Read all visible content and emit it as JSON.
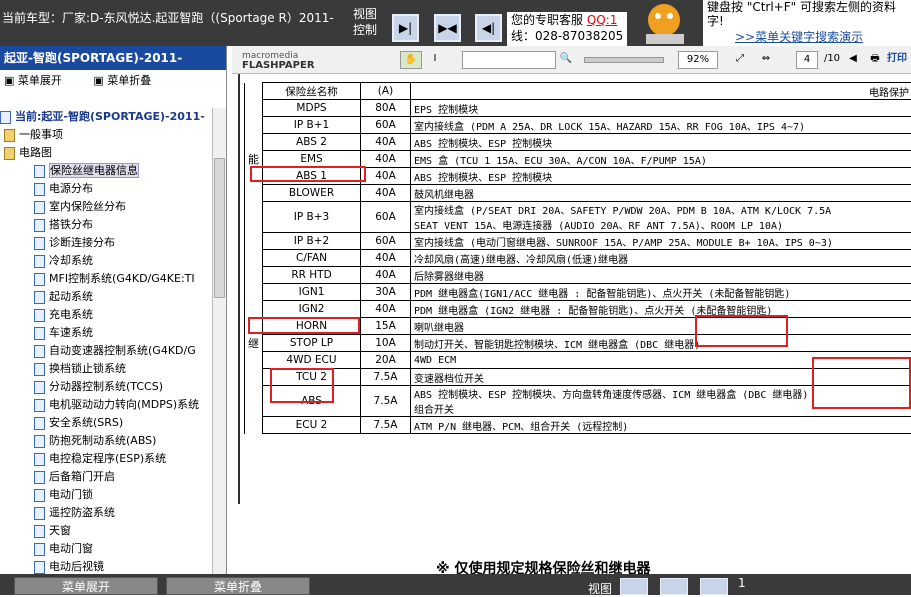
{
  "topbar": {
    "crumb": "当前车型：厂家:D-东风悦达.起亚智跑（(Sportage R）2011-",
    "view_label": "视图",
    "control_label": "控制",
    "nav": [
      "▶|",
      "▶◀",
      "◀|"
    ],
    "service_line1": "您的专职客服",
    "service_qq": "QQ:1",
    "service_line2": "线：028-87038205",
    "hint_line1": "键盘按 \"Ctrl+F\" 可搜索左侧的资料",
    "hint_line2": "字!",
    "hint_link": ">>菜单关键字搜索演示"
  },
  "sidebar": {
    "title": "起亚-智跑(SPORTAGE)-2011-",
    "expand": "菜单展开",
    "collapse": "菜单折叠",
    "current": "当前:起亚-智跑(SPORTAGE)-2011-",
    "items": [
      {
        "label": "一般事项",
        "level": 0
      },
      {
        "label": "电路图",
        "level": 0
      },
      {
        "label": "保险丝继电器信息",
        "level": 1
      },
      {
        "label": "电源分布",
        "level": 1
      },
      {
        "label": "室内保险丝分布",
        "level": 1
      },
      {
        "label": "搭铁分布",
        "level": 1
      },
      {
        "label": "诊断连接分布",
        "level": 1
      },
      {
        "label": "冷却系统",
        "level": 1
      },
      {
        "label": "MFI控制系统(G4KD/G4KE:TI",
        "level": 1
      },
      {
        "label": "起动系统",
        "level": 1
      },
      {
        "label": "充电系统",
        "level": 1
      },
      {
        "label": "车速系统",
        "level": 1
      },
      {
        "label": "自动变速器控制系统(G4KD/G",
        "level": 1
      },
      {
        "label": "换档锁止锁系统",
        "level": 1
      },
      {
        "label": "分动器控制系统(TCCS)",
        "level": 1
      },
      {
        "label": "电机驱动动力转向(MDPS)系统",
        "level": 1
      },
      {
        "label": "安全系统(SRS)",
        "level": 1
      },
      {
        "label": "防抱死制动系统(ABS)",
        "level": 1
      },
      {
        "label": "电控稳定程序(ESP)系统",
        "level": 1
      },
      {
        "label": "后备箱门开启",
        "level": 1
      },
      {
        "label": "电动门锁",
        "level": 1
      },
      {
        "label": "遥控防盗系统",
        "level": 1
      },
      {
        "label": "天窗",
        "level": 1
      },
      {
        "label": "电动门窗",
        "level": 1
      },
      {
        "label": "电动后视镜",
        "level": 1
      }
    ]
  },
  "viewer": {
    "logo_top": "macromedia",
    "logo_bottom": "FLASHPAPER",
    "zoom": "92%",
    "page_current": "4",
    "page_total": "/10",
    "print": "打印"
  },
  "table": {
    "header": [
      "保险丝名称",
      "(A)",
      "电路保护"
    ],
    "group1": "能",
    "group2": "继",
    "rows": [
      {
        "name": "MDPS",
        "amp": "80A",
        "desc": "EPS 控制模块"
      },
      {
        "name": "IP B+1",
        "amp": "60A",
        "desc": "室内接线盒 (PDM A 25A、DR LOCK 15A、HAZARD 15A、RR FOG 10A、IPS 4~7)"
      },
      {
        "name": "ABS 2",
        "amp": "40A",
        "desc": "ABS 控制模块、ESP 控制模块"
      },
      {
        "name": "EMS",
        "amp": "40A",
        "desc": "EMS 盒 (TCU 1 15A、ECU 30A、A/CON 10A、F/PUMP 15A)"
      },
      {
        "name": "ABS 1",
        "amp": "40A",
        "desc": "ABS 控制模块、ESP 控制模块"
      },
      {
        "name": "BLOWER",
        "amp": "40A",
        "desc": "鼓风机继电器"
      },
      {
        "name": "IP B+3",
        "amp": "60A",
        "desc": "室内接线盒 (P/SEAT DRI 20A、SAFETY P/WDW 20A、PDM B 10A、ATM K/LOCK 7.5A",
        "desc2": "SEAT VENT 15A、电源连接器 (AUDIO 20A、RF ANT 7.5A)、ROOM LP 10A)"
      },
      {
        "name": "IP B+2",
        "amp": "60A",
        "desc": "室内接线盒 (电动门窗继电器、SUNROOF 15A、P/AMP 25A、MODULE B+ 10A、IPS 0~3)"
      },
      {
        "name": "C/FAN",
        "amp": "40A",
        "desc": "冷却风扇(高速)继电器、冷却风扇(低速)继电器"
      },
      {
        "name": "RR HTD",
        "amp": "40A",
        "desc": "后除雾器继电器"
      },
      {
        "name": "IGN1",
        "amp": "30A",
        "desc": "PDM 继电器盒(IGN1/ACC 继电器 : 配备智能钥匙)、点火开关 (未配备智能钥匙)"
      },
      {
        "name": "IGN2",
        "amp": "40A",
        "desc": "PDM 继电器盒 (IGN2 继电器 : 配备智能钥匙)、点火开关 (未配备智能钥匙)"
      },
      {
        "name": "HORN",
        "amp": "15A",
        "desc": "喇叭继电器"
      },
      {
        "name": "STOP LP",
        "amp": "10A",
        "desc": "制动灯开关、智能钥匙控制模块、ICM 继电器盒 (DBC 继电器)"
      },
      {
        "name": "4WD ECU",
        "amp": "20A",
        "desc": "4WD ECM"
      },
      {
        "name": "TCU 2",
        "amp": "7.5A",
        "desc": "变速器档位开关"
      },
      {
        "name": "ABS",
        "amp": "7.5A",
        "desc": "ABS 控制模块、ESP 控制模块、方向盘转角速度传感器、ICM 继电器盒 (DBC 继电器)",
        "desc2": "组合开关"
      },
      {
        "name": "ECU 2",
        "amp": "7.5A",
        "desc": "ATM P/N 继电器、PCM、组合开关 (远程控制)"
      }
    ],
    "note": "※ 仅使用规定规格保险丝和继电器"
  },
  "bottom": {
    "expand": "菜单展开",
    "collapse": "菜单折叠",
    "view": "视图",
    "page": "1"
  }
}
